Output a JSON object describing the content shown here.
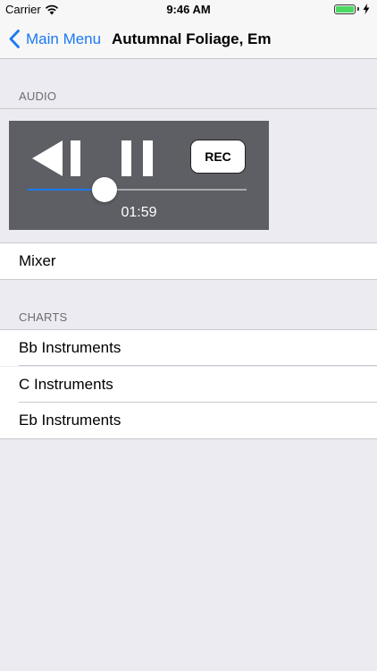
{
  "status_bar": {
    "carrier": "Carrier",
    "time": "9:46 AM",
    "battery_level": 1.0,
    "battery_color": "#4cd964"
  },
  "nav": {
    "back_label": "Main Menu",
    "title": "Autumnal Foliage, Em",
    "tint_color": "#1b79f4"
  },
  "audio": {
    "header": "AUDIO",
    "rec_label": "REC",
    "time": "01:59",
    "progress": 0.35,
    "icons": [
      "rewind-icon",
      "pause-icon"
    ]
  },
  "mixer": {
    "label": "Mixer"
  },
  "charts": {
    "header": "CHARTS",
    "items": [
      {
        "label": "Bb Instruments"
      },
      {
        "label": "C Instruments"
      },
      {
        "label": "Eb Instruments"
      }
    ]
  }
}
